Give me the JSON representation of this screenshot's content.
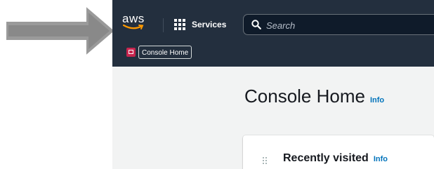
{
  "header": {
    "logo_text": "aws",
    "logo_icon": "aws-logo",
    "services_label": "Services",
    "services_icon": "grid-icon",
    "search_placeholder": "Search",
    "search_icon": "search-icon"
  },
  "favorites": [
    {
      "label": "Console Home",
      "icon": "console-home-icon"
    }
  ],
  "main": {
    "page_title": "Console Home",
    "page_title_info": "Info",
    "widget": {
      "title": "Recently visited",
      "info": "Info",
      "drag_icon": "drag-handle-icon"
    }
  },
  "annotation": {
    "icon": "arrow-icon",
    "color": "#999999"
  },
  "colors": {
    "topbar_bg": "#232f3e",
    "page_bg": "#f2f3f3",
    "link": "#0073bb",
    "logo_smile": "#ff9900"
  }
}
